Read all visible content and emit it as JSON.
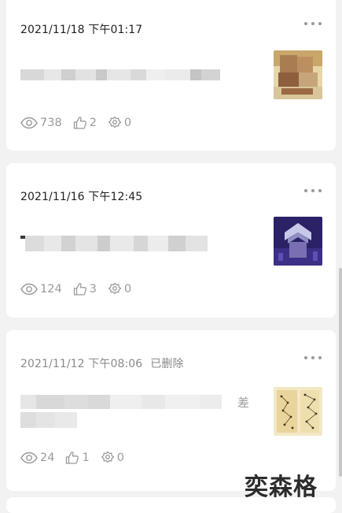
{
  "posts": [
    {
      "date": "2021/11/18 下午01:17",
      "views": "738",
      "likes": "2",
      "shares": "0"
    },
    {
      "date": "2021/11/16 下午12:45",
      "views": "124",
      "likes": "3",
      "shares": "0"
    },
    {
      "date": "2021/11/12 下午08:06",
      "status": "已删除",
      "partial_text": "差",
      "views": "24",
      "likes": "1",
      "shares": "0"
    }
  ],
  "icons": {
    "more": "more-horizontal-icon",
    "views": "eye-icon",
    "likes": "thumbs-up-icon",
    "shares": "share-icon"
  },
  "watermark": "奕森格"
}
